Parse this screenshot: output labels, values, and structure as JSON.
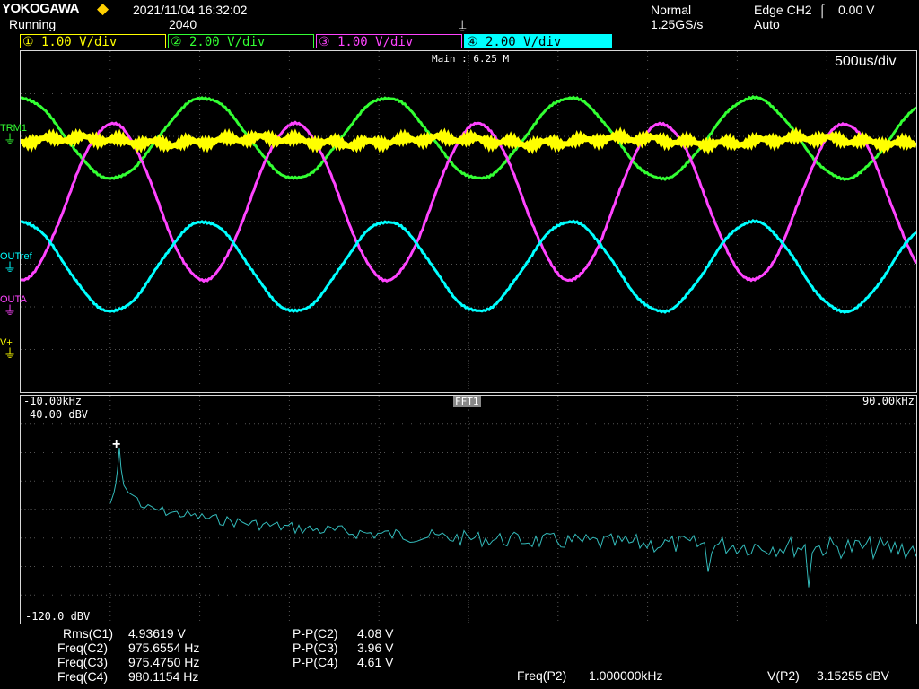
{
  "header": {
    "brand": "YOKOGAWA",
    "status": "Running",
    "datetime": "2021/11/04 16:32:02",
    "acq_count": "2040",
    "acq_mode": "Normal",
    "sample_rate": "1.25GS/s",
    "trigger": "Edge CH2",
    "trigger_level": "0.00 V",
    "trigger_mode": "Auto"
  },
  "channels": [
    {
      "num": "1",
      "scale": "1.00 V/div",
      "color": "#ffff00"
    },
    {
      "num": "2",
      "scale": "2.00 V/div",
      "color": "#33ff33"
    },
    {
      "num": "3",
      "scale": "1.00 V/div",
      "color": "#ff44ff"
    },
    {
      "num": "4",
      "scale": "2.00 V/div",
      "color": "#00ffff"
    }
  ],
  "main_window": {
    "zoom_label": "Main : 6.25 M",
    "timebase": "500us/div",
    "markers": [
      "TRM1",
      "OUTref",
      "OUTA",
      "V+"
    ]
  },
  "fft_window": {
    "label": "FFT1",
    "freq_start": "-10.00kHz",
    "freq_end": "90.00kHz",
    "top_level": "40.00 dBV",
    "bottom_level": "-120.0 dBV"
  },
  "measurements_left": [
    {
      "label": "Rms(C1)",
      "value": "4.93619 V"
    },
    {
      "label": "Freq(C2)",
      "value": "975.6554 Hz"
    },
    {
      "label": "Freq(C3)",
      "value": "975.4750 Hz"
    },
    {
      "label": "Freq(C4)",
      "value": "980.1154 Hz"
    }
  ],
  "measurements_mid": [
    {
      "label": "P-P(C2)",
      "value": "4.08 V"
    },
    {
      "label": "P-P(C3)",
      "value": "3.96 V"
    },
    {
      "label": "P-P(C4)",
      "value": "4.61 V"
    }
  ],
  "measurements_bottom": [
    {
      "label": "Freq(P2)",
      "value": "1.000000kHz"
    },
    {
      "label": "V(P2)",
      "value": "3.15255 dBV"
    }
  ]
}
